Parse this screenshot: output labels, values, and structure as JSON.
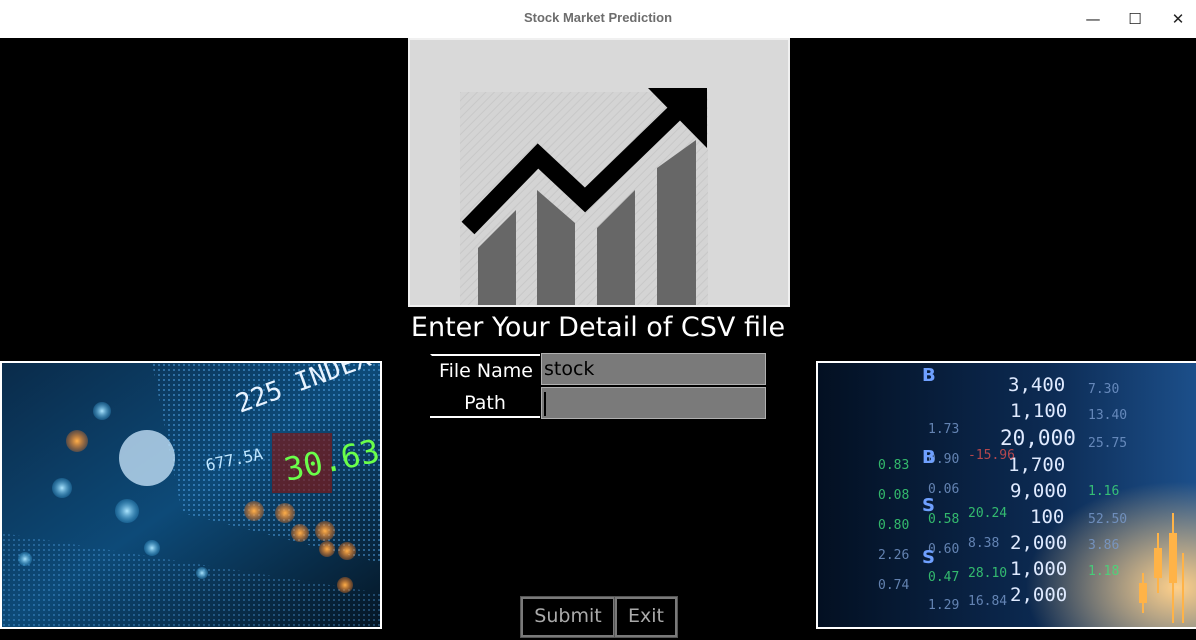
{
  "window": {
    "title": "Stock Market Prediction",
    "minimize_glyph": "—",
    "maximize_glyph": "☐",
    "close_glyph": "✕"
  },
  "logo": {
    "icon": "growth-chart-arrow-icon",
    "bar_color": "#666666",
    "arrow_color": "#000000",
    "background": "#d9d9d9"
  },
  "heading": "Enter Your Detail of CSV file",
  "form": {
    "file_name_label": "File Name",
    "file_name_value": "stock",
    "path_label": "Path",
    "path_value": ""
  },
  "images": {
    "left": "stock-index-led-board-photo",
    "right": "stock-ticker-numbers-board-photo"
  },
  "buttons": {
    "submit": "Submit",
    "exit": "Exit"
  },
  "ticker_right": [
    "3,400",
    "1,100",
    "20,000",
    "1,700",
    "9,000",
    "100",
    "2,000",
    "1,000",
    "2,000"
  ],
  "ticker_left": [
    "225 INDEX",
    "30.63",
    "677.5A"
  ]
}
